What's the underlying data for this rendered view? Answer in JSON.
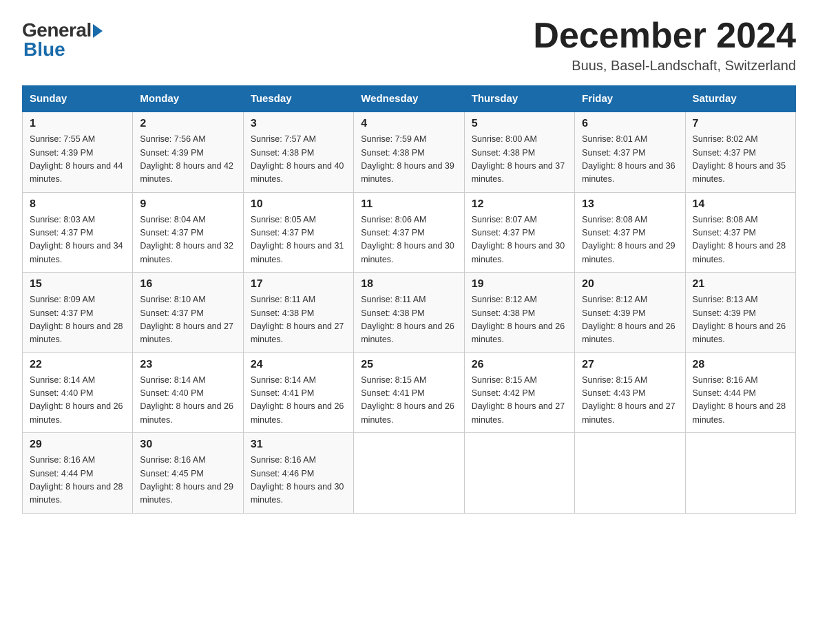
{
  "logo": {
    "general": "General",
    "blue": "Blue"
  },
  "title": "December 2024",
  "subtitle": "Buus, Basel-Landschaft, Switzerland",
  "weekdays": [
    "Sunday",
    "Monday",
    "Tuesday",
    "Wednesday",
    "Thursday",
    "Friday",
    "Saturday"
  ],
  "weeks": [
    [
      {
        "day": "1",
        "sunrise": "7:55 AM",
        "sunset": "4:39 PM",
        "daylight": "8 hours and 44 minutes."
      },
      {
        "day": "2",
        "sunrise": "7:56 AM",
        "sunset": "4:39 PM",
        "daylight": "8 hours and 42 minutes."
      },
      {
        "day": "3",
        "sunrise": "7:57 AM",
        "sunset": "4:38 PM",
        "daylight": "8 hours and 40 minutes."
      },
      {
        "day": "4",
        "sunrise": "7:59 AM",
        "sunset": "4:38 PM",
        "daylight": "8 hours and 39 minutes."
      },
      {
        "day": "5",
        "sunrise": "8:00 AM",
        "sunset": "4:38 PM",
        "daylight": "8 hours and 37 minutes."
      },
      {
        "day": "6",
        "sunrise": "8:01 AM",
        "sunset": "4:37 PM",
        "daylight": "8 hours and 36 minutes."
      },
      {
        "day": "7",
        "sunrise": "8:02 AM",
        "sunset": "4:37 PM",
        "daylight": "8 hours and 35 minutes."
      }
    ],
    [
      {
        "day": "8",
        "sunrise": "8:03 AM",
        "sunset": "4:37 PM",
        "daylight": "8 hours and 34 minutes."
      },
      {
        "day": "9",
        "sunrise": "8:04 AM",
        "sunset": "4:37 PM",
        "daylight": "8 hours and 32 minutes."
      },
      {
        "day": "10",
        "sunrise": "8:05 AM",
        "sunset": "4:37 PM",
        "daylight": "8 hours and 31 minutes."
      },
      {
        "day": "11",
        "sunrise": "8:06 AM",
        "sunset": "4:37 PM",
        "daylight": "8 hours and 30 minutes."
      },
      {
        "day": "12",
        "sunrise": "8:07 AM",
        "sunset": "4:37 PM",
        "daylight": "8 hours and 30 minutes."
      },
      {
        "day": "13",
        "sunrise": "8:08 AM",
        "sunset": "4:37 PM",
        "daylight": "8 hours and 29 minutes."
      },
      {
        "day": "14",
        "sunrise": "8:08 AM",
        "sunset": "4:37 PM",
        "daylight": "8 hours and 28 minutes."
      }
    ],
    [
      {
        "day": "15",
        "sunrise": "8:09 AM",
        "sunset": "4:37 PM",
        "daylight": "8 hours and 28 minutes."
      },
      {
        "day": "16",
        "sunrise": "8:10 AM",
        "sunset": "4:37 PM",
        "daylight": "8 hours and 27 minutes."
      },
      {
        "day": "17",
        "sunrise": "8:11 AM",
        "sunset": "4:38 PM",
        "daylight": "8 hours and 27 minutes."
      },
      {
        "day": "18",
        "sunrise": "8:11 AM",
        "sunset": "4:38 PM",
        "daylight": "8 hours and 26 minutes."
      },
      {
        "day": "19",
        "sunrise": "8:12 AM",
        "sunset": "4:38 PM",
        "daylight": "8 hours and 26 minutes."
      },
      {
        "day": "20",
        "sunrise": "8:12 AM",
        "sunset": "4:39 PM",
        "daylight": "8 hours and 26 minutes."
      },
      {
        "day": "21",
        "sunrise": "8:13 AM",
        "sunset": "4:39 PM",
        "daylight": "8 hours and 26 minutes."
      }
    ],
    [
      {
        "day": "22",
        "sunrise": "8:14 AM",
        "sunset": "4:40 PM",
        "daylight": "8 hours and 26 minutes."
      },
      {
        "day": "23",
        "sunrise": "8:14 AM",
        "sunset": "4:40 PM",
        "daylight": "8 hours and 26 minutes."
      },
      {
        "day": "24",
        "sunrise": "8:14 AM",
        "sunset": "4:41 PM",
        "daylight": "8 hours and 26 minutes."
      },
      {
        "day": "25",
        "sunrise": "8:15 AM",
        "sunset": "4:41 PM",
        "daylight": "8 hours and 26 minutes."
      },
      {
        "day": "26",
        "sunrise": "8:15 AM",
        "sunset": "4:42 PM",
        "daylight": "8 hours and 27 minutes."
      },
      {
        "day": "27",
        "sunrise": "8:15 AM",
        "sunset": "4:43 PM",
        "daylight": "8 hours and 27 minutes."
      },
      {
        "day": "28",
        "sunrise": "8:16 AM",
        "sunset": "4:44 PM",
        "daylight": "8 hours and 28 minutes."
      }
    ],
    [
      {
        "day": "29",
        "sunrise": "8:16 AM",
        "sunset": "4:44 PM",
        "daylight": "8 hours and 28 minutes."
      },
      {
        "day": "30",
        "sunrise": "8:16 AM",
        "sunset": "4:45 PM",
        "daylight": "8 hours and 29 minutes."
      },
      {
        "day": "31",
        "sunrise": "8:16 AM",
        "sunset": "4:46 PM",
        "daylight": "8 hours and 30 minutes."
      },
      null,
      null,
      null,
      null
    ]
  ]
}
